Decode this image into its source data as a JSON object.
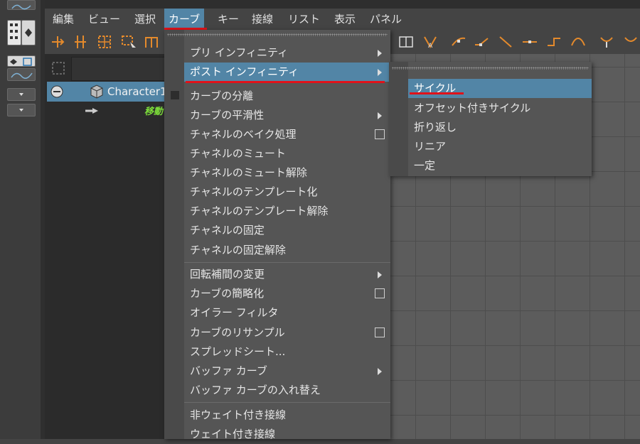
{
  "menubar": {
    "items": [
      "編集",
      "ビュー",
      "選択",
      "カーブ",
      "キー",
      "接線",
      "リスト",
      "表示",
      "パネル"
    ],
    "active": "カーブ"
  },
  "outliner": {
    "character": "Character1",
    "move": "移動"
  },
  "curve_menu": {
    "items": [
      {
        "label": "プリ インフィニティ",
        "type": "submenu"
      },
      {
        "label": "ポスト インフィニティ",
        "type": "submenu",
        "active": true
      },
      {
        "label": "カーブの分離",
        "type": "item"
      },
      {
        "label": "カーブの平滑性",
        "type": "submenu"
      },
      {
        "label": "チャネルのベイク処理",
        "type": "option"
      },
      {
        "label": "チャネルのミュート",
        "type": "item"
      },
      {
        "label": "チャネルのミュート解除",
        "type": "item"
      },
      {
        "label": "チャネルのテンプレート化",
        "type": "item"
      },
      {
        "label": "チャネルのテンプレート解除",
        "type": "item"
      },
      {
        "label": "チャネルの固定",
        "type": "item"
      },
      {
        "label": "チャネルの固定解除",
        "type": "item"
      },
      {
        "label": "回転補間の変更",
        "type": "submenu"
      },
      {
        "label": "カーブの簡略化",
        "type": "option"
      },
      {
        "label": "オイラー フィルタ",
        "type": "item"
      },
      {
        "label": "カーブのリサンプル",
        "type": "option"
      },
      {
        "label": "スプレッドシート...",
        "type": "item"
      },
      {
        "label": "バッファ カーブ",
        "type": "submenu"
      },
      {
        "label": "バッファ カーブの入れ替え",
        "type": "item"
      },
      {
        "label": "非ウェイト付き接線",
        "type": "item"
      },
      {
        "label": "ウェイト付き接線",
        "type": "item"
      }
    ]
  },
  "post_infinity_submenu": {
    "items": [
      "サイクル",
      "オフセット付きサイクル",
      "折り返し",
      "リニア",
      "一定"
    ],
    "active": "サイクル"
  },
  "colors": {
    "highlight": "#5285a6",
    "annotation_red": "#e0121a",
    "move_label": "#7ddf3a"
  }
}
